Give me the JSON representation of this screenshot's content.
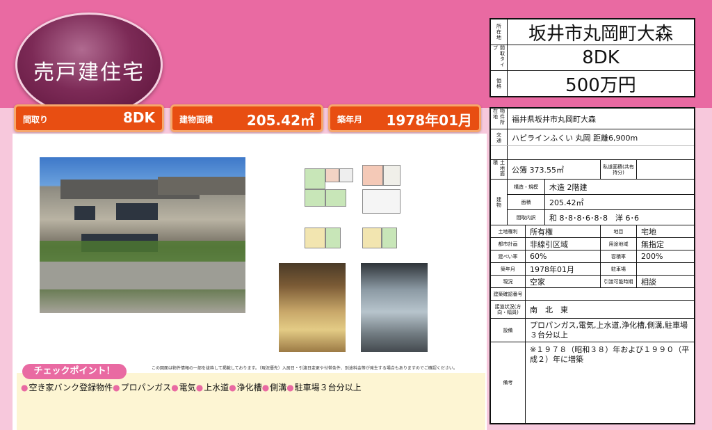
{
  "header": {
    "title": "売戸建住宅"
  },
  "summary": [
    {
      "label": "間取り",
      "value": "8DK"
    },
    {
      "label": "建物面積",
      "value": "205.42㎡"
    },
    {
      "label": "築年月",
      "value": "1978年01月"
    }
  ],
  "top_box": {
    "location_label": "所在地",
    "location": "坂井市丸岡町大森",
    "layout_label": "間取タイプ",
    "layout": "8DK",
    "price_label": "価格",
    "price": "500万円"
  },
  "details": {
    "address_label": "物件所在地",
    "address": "福井県坂井市丸岡町大森",
    "transport_label": "交通",
    "transport": "ハピラインふくい 丸岡 距離6,900m",
    "land_area_label": "土地面積",
    "land_area": "公簿 373.55㎡",
    "private_road_label": "私道面積(共有持分)",
    "building_label": "建物",
    "structure_label": "構造・規模",
    "structure": "木造 2階建",
    "floor_area_label": "面積",
    "floor_area": "205.42㎡",
    "rooms_label": "間取内訳",
    "rooms": "和 8･8･8･6･8･8　洋 6･6",
    "land_rights_label": "土地権利",
    "land_rights": "所有権",
    "land_category_label": "地目",
    "land_category": "宅地",
    "city_plan_label": "都市計画",
    "city_plan": "非線引区域",
    "zoning_label": "用途地域",
    "zoning": "無指定",
    "coverage_label": "建ぺい率",
    "coverage": "60%",
    "far_label": "容積率",
    "far": "200%",
    "built_label": "築年月",
    "built": "1978年01月",
    "parking_label": "駐車場",
    "status_label": "現況",
    "status": "空家",
    "handover_label": "引渡可能時期",
    "handover": "相談",
    "confirmation_label": "建築確認番号",
    "road_label": "接道状況(方向・幅員)",
    "road": "南　北　東",
    "facilities_label": "設備",
    "facilities": "プロパンガス,電気,上水道,浄化槽,側溝,駐車場３台分以上",
    "remarks_label": "備考",
    "remarks": "※１９７８（昭和３８）年および１９９０（平成２）年に増築"
  },
  "notice": "この図面は物件情報の一部を抜粋して掲載しております。（現況優先）入居日・引渡日変更や付帯条件、別途料金等が発生する場合もありますのでご確認ください。",
  "check": {
    "title": "チェックポイント！",
    "items": [
      "空き家バンク登録物件",
      "プロパンガス",
      "電気",
      "上水道",
      "浄化槽",
      "側溝",
      "駐車場３台分以上"
    ]
  },
  "colors": {
    "band": "#e96aa2",
    "background": "#f7c8dc",
    "pill": "#e84e12",
    "check_area": "#fdf5d3"
  }
}
